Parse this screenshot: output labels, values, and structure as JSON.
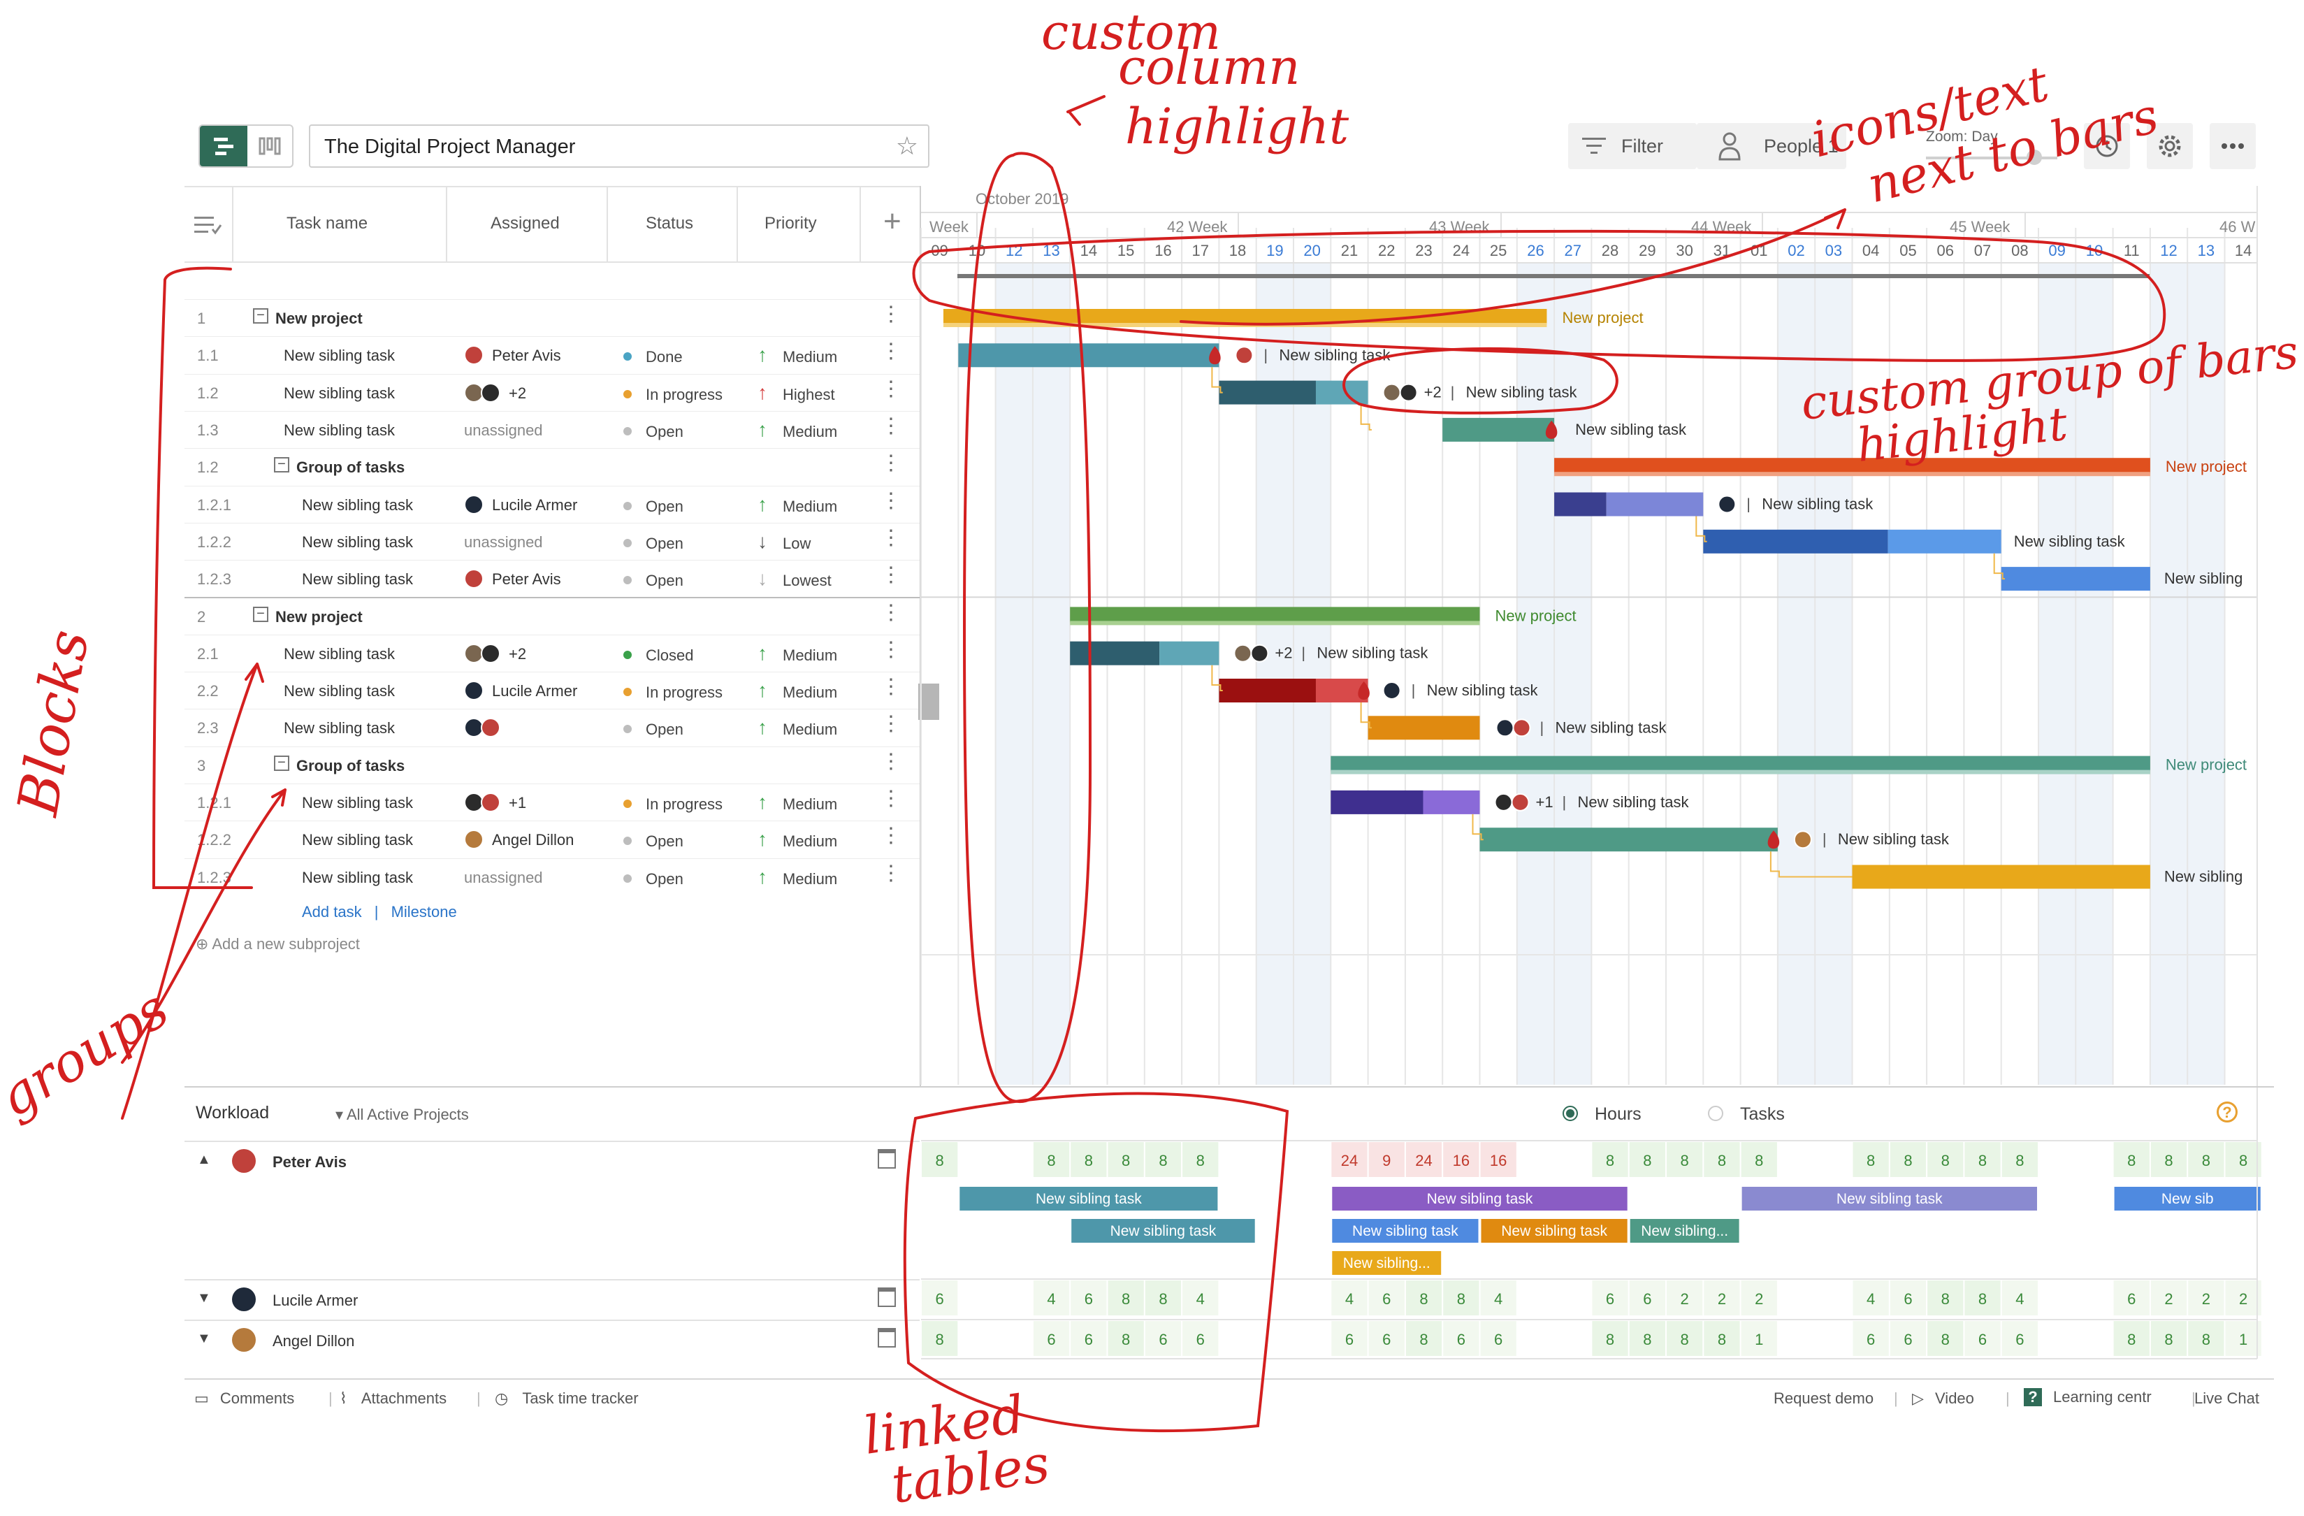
{
  "app": {
    "project_title": "The Digital Project Manager",
    "filter_label": "Filter",
    "people_label": "People 1",
    "zoom_label": "Zoom: Day"
  },
  "columns": {
    "task": "Task name",
    "assigned": "Assigned",
    "status": "Status",
    "priority": "Priority"
  },
  "timeline": {
    "month": "October 2019",
    "weeks": [
      "Week",
      "42 Week",
      "43 Week",
      "44 Week",
      "45 Week",
      "46 W"
    ],
    "days": [
      "09",
      "10",
      "12",
      "13",
      "14",
      "15",
      "16",
      "17",
      "18",
      "19",
      "20",
      "21",
      "22",
      "23",
      "24",
      "25",
      "26",
      "27",
      "28",
      "29",
      "30",
      "31",
      "01",
      "02",
      "03",
      "04",
      "05",
      "06",
      "07",
      "08",
      "09",
      "10",
      "11",
      "12",
      "13",
      "14"
    ],
    "weekend_days": [
      "12",
      "13",
      "19",
      "20",
      "26",
      "27",
      "02",
      "03",
      "09",
      "10"
    ]
  },
  "rows": [
    {
      "num": "1",
      "name": "New project",
      "assigned": "",
      "avatars": [],
      "status": "",
      "priority": "",
      "level": 0,
      "bold": true,
      "toggle": true
    },
    {
      "num": "1.1",
      "name": "New sibling task",
      "assigned": "Peter Avis",
      "avatars": [
        "#c0413b"
      ],
      "status": "Done",
      "status_color": "#4aa4c4",
      "priority": "Medium",
      "prio_arrow": "↑",
      "prio_color": "#3aa14a",
      "level": 1
    },
    {
      "num": "1.2",
      "name": "New sibling task",
      "assigned": "+2",
      "avatars": [
        "#7a6650",
        "#2b2b2b"
      ],
      "status": "In progress",
      "status_color": "#e8a030",
      "priority": "Highest",
      "prio_arrow": "↑",
      "prio_color": "#d33c3c",
      "level": 1
    },
    {
      "num": "1.3",
      "name": "New sibling task",
      "assigned": "unassigned",
      "avatars": [],
      "status": "Open",
      "status_color": "#bdbdbd",
      "priority": "Medium",
      "prio_arrow": "↑",
      "prio_color": "#3aa14a",
      "level": 1,
      "muted": true
    },
    {
      "num": "1.2",
      "name": "Group of tasks",
      "assigned": "",
      "avatars": [],
      "status": "",
      "priority": "",
      "level": 1,
      "bold": true,
      "toggle": true
    },
    {
      "num": "1.2.1",
      "name": "New sibling task",
      "assigned": "Lucile Armer",
      "avatars": [
        "#1f2a3a"
      ],
      "status": "Open",
      "status_color": "#bdbdbd",
      "priority": "Medium",
      "prio_arrow": "↑",
      "prio_color": "#3aa14a",
      "level": 2
    },
    {
      "num": "1.2.2",
      "name": "New sibling task",
      "assigned": "unassigned",
      "avatars": [],
      "status": "Open",
      "status_color": "#bdbdbd",
      "priority": "Low",
      "prio_arrow": "↓",
      "prio_color": "#555555",
      "level": 2,
      "muted": true
    },
    {
      "num": "1.2.3",
      "name": "New sibling task",
      "assigned": "Peter Avis",
      "avatars": [
        "#c0413b"
      ],
      "status": "Open",
      "status_color": "#bdbdbd",
      "priority": "Lowest",
      "prio_arrow": "↓",
      "prio_color": "#aaaaaa",
      "level": 2
    },
    {
      "num": "2",
      "name": "New project",
      "assigned": "",
      "avatars": [],
      "status": "",
      "priority": "",
      "level": 0,
      "bold": true,
      "toggle": true
    },
    {
      "num": "2.1",
      "name": "New sibling task",
      "assigned": "+2",
      "avatars": [
        "#7a6650",
        "#2b2b2b"
      ],
      "status": "Closed",
      "status_color": "#3aa14a",
      "priority": "Medium",
      "prio_arrow": "↑",
      "prio_color": "#3aa14a",
      "level": 1
    },
    {
      "num": "2.2",
      "name": "New sibling task",
      "assigned": "Lucile Armer",
      "avatars": [
        "#1f2a3a"
      ],
      "status": "In progress",
      "status_color": "#e8a030",
      "priority": "Medium",
      "prio_arrow": "↑",
      "prio_color": "#3aa14a",
      "level": 1
    },
    {
      "num": "2.3",
      "name": "New sibling task",
      "assigned": "",
      "avatars": [
        "#1f2a3a",
        "#c0413b"
      ],
      "status": "Open",
      "status_color": "#bdbdbd",
      "priority": "Medium",
      "prio_arrow": "↑",
      "prio_color": "#3aa14a",
      "level": 1
    },
    {
      "num": "3",
      "name": "Group of tasks",
      "assigned": "",
      "avatars": [],
      "status": "",
      "priority": "",
      "level": 1,
      "bold": true,
      "toggle": true
    },
    {
      "num": "1.2.1",
      "name": "New sibling task",
      "assigned": "+1",
      "avatars": [
        "#2b2b2b",
        "#c0413b"
      ],
      "status": "In progress",
      "status_color": "#e8a030",
      "priority": "Medium",
      "prio_arrow": "↑",
      "prio_color": "#3aa14a",
      "level": 2
    },
    {
      "num": "1.2.2",
      "name": "New sibling task",
      "assigned": "Angel Dillon",
      "avatars": [
        "#b57a3c"
      ],
      "status": "Open",
      "status_color": "#bdbdbd",
      "priority": "Medium",
      "prio_arrow": "↑",
      "prio_color": "#3aa14a",
      "level": 2
    },
    {
      "num": "1.2.3",
      "name": "New sibling task",
      "assigned": "unassigned",
      "avatars": [],
      "status": "Open",
      "status_color": "#bdbdbd",
      "priority": "Medium",
      "prio_arrow": "↑",
      "prio_color": "#3aa14a",
      "level": 2,
      "muted": true
    }
  ],
  "add_task": "Add task",
  "add_milestone": "Milestone",
  "add_subproject": "Add a new subproject",
  "bar_labels": {
    "project": "New project",
    "sibling": "New sibling task",
    "sibling_short": "New sibling",
    "plus2": "+2",
    "plus1": "+1"
  },
  "workload": {
    "title": "Workload",
    "filter": "All Active Projects",
    "hours": "Hours",
    "tasks": "Tasks",
    "people": [
      {
        "name": "Peter Avis",
        "avatar": "#c0413b",
        "expanded": true,
        "cells": [
          "8",
          "",
          "",
          "8",
          "8",
          "8",
          "8",
          "8",
          "",
          "",
          "",
          "24",
          "9",
          "24",
          "16",
          "16",
          "",
          "",
          "8",
          "8",
          "8",
          "8",
          "8",
          "",
          "",
          "8",
          "8",
          "8",
          "8",
          "8",
          "",
          "",
          "8",
          "8",
          "8",
          "8"
        ],
        "bars": [
          {
            "label": "New sibling task",
            "color": "#4e97aa"
          },
          {
            "label": "New sibling task",
            "color": "#4e97aa"
          },
          {
            "label": "New sibling task",
            "color": "#8a5cc4"
          },
          {
            "label": "New sibling task",
            "color": "#4f8ae0"
          },
          {
            "label": "New sibling task",
            "color": "#e08a10"
          },
          {
            "label": "New sibling...",
            "color": "#4f9a86"
          },
          {
            "label": "New sibling...",
            "color": "#e8a81a"
          },
          {
            "label": "New sibling task",
            "color": "#8a8ad0"
          },
          {
            "label": "New sib",
            "color": "#4f8ae0"
          }
        ]
      },
      {
        "name": "Lucile Armer",
        "avatar": "#1f2a3a",
        "expanded": false,
        "cells": [
          "6",
          "",
          "",
          "4",
          "6",
          "8",
          "8",
          "4",
          "",
          "",
          "",
          "4",
          "6",
          "8",
          "8",
          "4",
          "",
          "",
          "6",
          "6",
          "2",
          "2",
          "2",
          "",
          "",
          "4",
          "6",
          "8",
          "8",
          "4",
          "",
          "",
          "6",
          "2",
          "2",
          "2"
        ]
      },
      {
        "name": "Angel Dillon",
        "avatar": "#b57a3c",
        "expanded": false,
        "cells": [
          "8",
          "",
          "",
          "6",
          "6",
          "8",
          "6",
          "6",
          "",
          "",
          "",
          "6",
          "6",
          "8",
          "6",
          "6",
          "",
          "",
          "8",
          "8",
          "8",
          "8",
          "1",
          "",
          "",
          "6",
          "6",
          "8",
          "6",
          "6",
          "",
          "",
          "8",
          "8",
          "8",
          "1"
        ]
      }
    ]
  },
  "footer": {
    "comments": "Comments",
    "attachments": "Attachments",
    "tracker": "Task time tracker",
    "demo": "Request demo",
    "video": "Video",
    "learning": "Learning centr",
    "chat": "Live Chat"
  },
  "annotations": {
    "custom_column_1": "custom",
    "custom_column_2": "column",
    "custom_column_3": "highlight",
    "icons_1": "icons/text",
    "icons_2": "next to bars",
    "group_1": "custom group of bars",
    "group_2": "highlight",
    "blocks": "Blocks",
    "groups": "groups",
    "linked_1": "linked",
    "linked_2": "tables"
  },
  "colors": {
    "accent": "#2f6b57",
    "annotation": "#d41f1f",
    "weekend": "#eef3f9",
    "blue_day": "#3a7bd5"
  }
}
